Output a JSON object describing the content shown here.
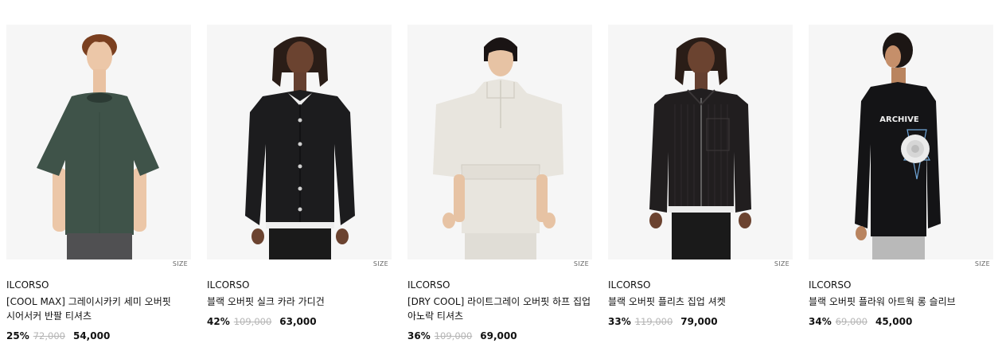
{
  "products": [
    {
      "brand": "ILCORSO",
      "name": "[COOL MAX] 그레이시카키 세미 오버핏 시어서커 반팔 티셔츠",
      "size_label": "SIZE",
      "discount": "25%",
      "original_price": "72,000",
      "sale_price": "54,000",
      "image": "model-green-tshirt",
      "garment_color": "#3f5349"
    },
    {
      "brand": "ILCORSO",
      "name": "블랙 오버핏 실크 카라 가디건",
      "size_label": "SIZE",
      "discount": "42%",
      "original_price": "109,000",
      "sale_price": "63,000",
      "image": "model-black-cardigan",
      "garment_color": "#1c1c1e"
    },
    {
      "brand": "ILCORSO",
      "name": "[DRY COOL] 라이트그레이 오버핏 하프 집업 아노락 티셔츠",
      "size_label": "SIZE",
      "discount": "36%",
      "original_price": "109,000",
      "sale_price": "69,000",
      "image": "model-light-gray-anorak",
      "garment_color": "#e8e5de"
    },
    {
      "brand": "ILCORSO",
      "name": "블랙 오버핏 플리츠 집업 셔켓",
      "size_label": "SIZE",
      "discount": "33%",
      "original_price": "119,000",
      "sale_price": "79,000",
      "image": "model-black-pleats-shacket",
      "garment_color": "#211e1f"
    },
    {
      "brand": "ILCORSO",
      "name": "블랙 오버핏 플라워 아트웍 롱 슬리브",
      "size_label": "SIZE",
      "discount": "34%",
      "original_price": "69,000",
      "sale_price": "45,000",
      "image": "model-black-flower-longsleeve",
      "garment_color": "#141416"
    }
  ]
}
